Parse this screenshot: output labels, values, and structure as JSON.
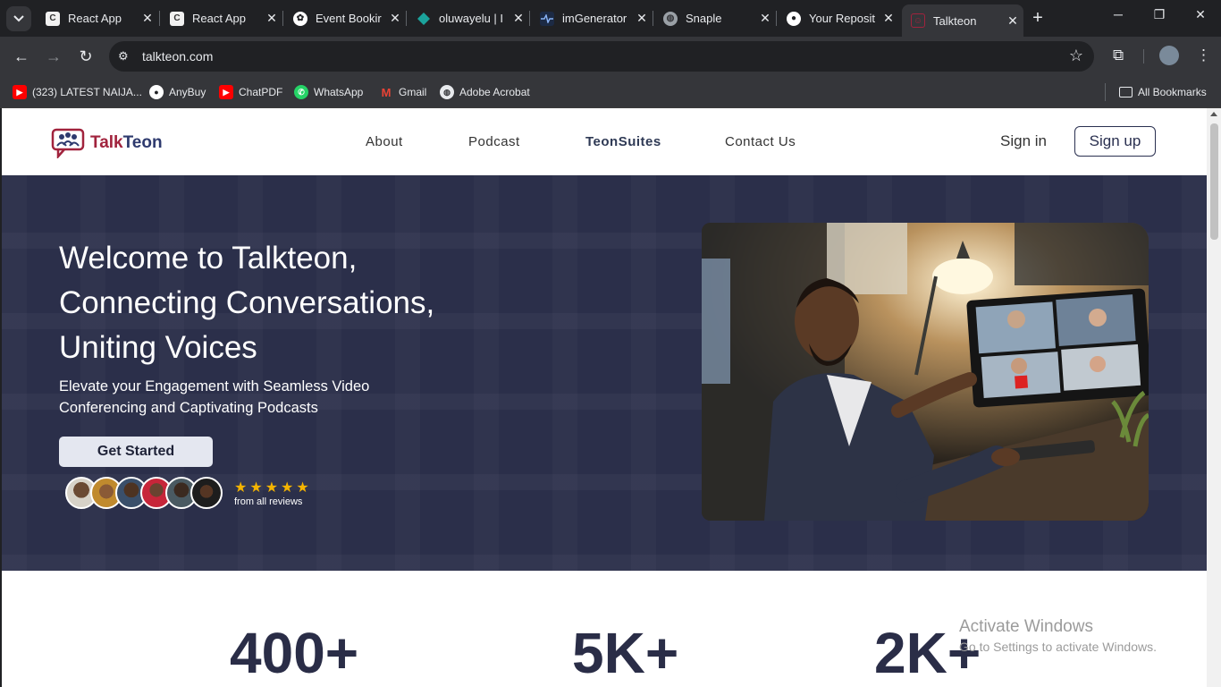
{
  "browser": {
    "tabs": [
      {
        "label": "React App",
        "favicon": "react-app-icon",
        "color": "#f1f1f1"
      },
      {
        "label": "React App",
        "favicon": "react-app-icon",
        "color": "#f1f1f1"
      },
      {
        "label": "Event Bookir",
        "favicon": "chatgpt-icon",
        "color": "#ffffff"
      },
      {
        "label": "oluwayelu | I",
        "favicon": "diamond-icon",
        "color": "#1ba39c"
      },
      {
        "label": "imGenerator",
        "favicon": "pulse-icon",
        "color": "#1c2a44"
      },
      {
        "label": "Snaple",
        "favicon": "globe-icon",
        "color": "#9aa0a6"
      },
      {
        "label": "Your Reposit",
        "favicon": "github-icon",
        "color": "#ffffff"
      },
      {
        "label": "Talkteon",
        "favicon": "talkteon-icon",
        "color": "#a1233d"
      }
    ],
    "url": "talkteon.com",
    "bookmarks": [
      {
        "label": "(323) LATEST NAIJA...",
        "icon": "youtube-icon",
        "color": "#ff0000"
      },
      {
        "label": "AnyBuy",
        "icon": "github-icon",
        "color": "#ffffff"
      },
      {
        "label": "ChatPDF",
        "icon": "youtube-icon",
        "color": "#ff0000"
      },
      {
        "label": "WhatsApp",
        "icon": "whatsapp-icon",
        "color": "#25d366"
      },
      {
        "label": "Gmail",
        "icon": "gmail-icon",
        "color": "#ea4335"
      },
      {
        "label": "Adobe Acrobat",
        "icon": "globe-icon",
        "color": "#e8eaed"
      }
    ],
    "all_bookmarks": "All Bookmarks"
  },
  "site": {
    "logo": {
      "text_primary": "Talk",
      "text_secondary": "Teon"
    },
    "nav": [
      "About",
      "Podcast",
      "TeonSuites",
      "Contact Us"
    ],
    "sign_in": "Sign in",
    "sign_up": "Sign up"
  },
  "hero": {
    "title_line1": "Welcome to Talkteon,",
    "title_line2": "Connecting Conversations,",
    "title_line3": "Uniting Voices",
    "subtitle": "Elevate your Engagement with Seamless Video Conferencing and Captivating Podcasts",
    "cta": "Get Started",
    "stars": 5,
    "reviews_label": "from all reviews"
  },
  "stats": [
    "400+",
    "5K+",
    "2K+"
  ],
  "watermark": {
    "line1": "Activate Windows",
    "line2": "Go to Settings to activate Windows."
  },
  "colors": {
    "brand_navy": "#2b2f4a",
    "brand_red": "#a1233d",
    "star": "#f5b400"
  }
}
